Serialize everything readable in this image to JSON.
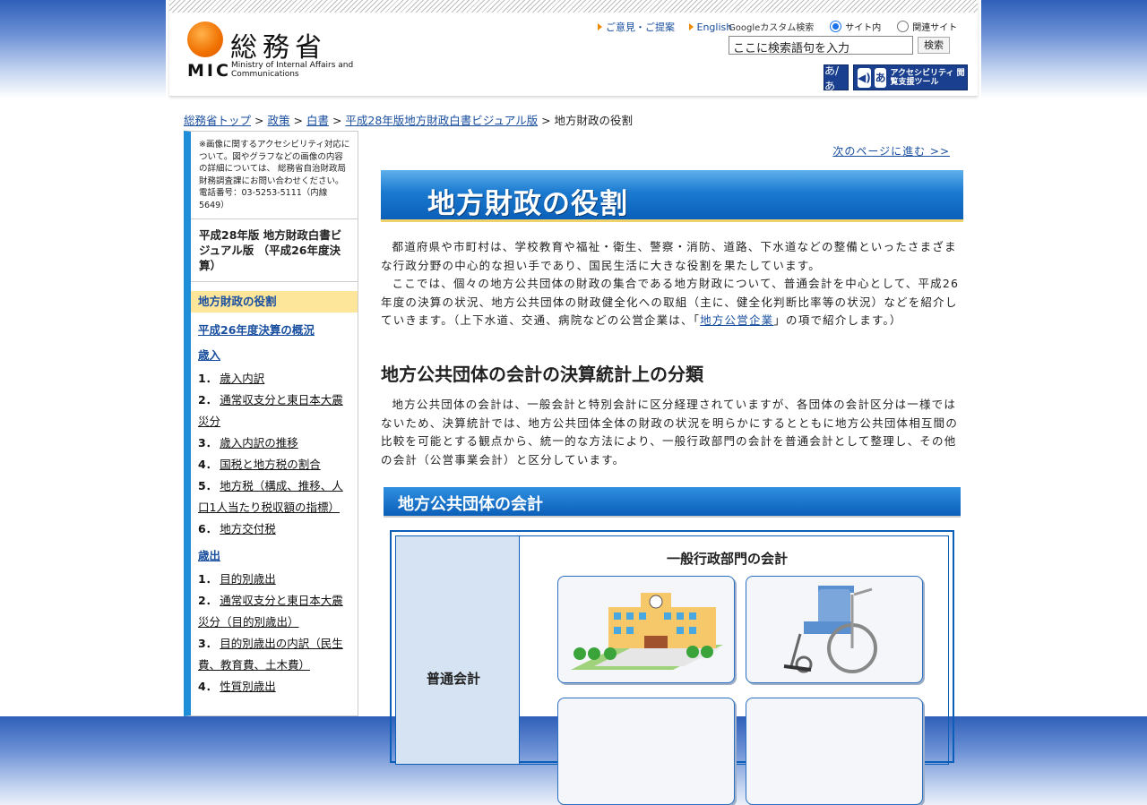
{
  "header": {
    "logo_jp": "総務省",
    "logo_mic": "MIC",
    "logo_en": "Ministry of Internal Affairs and Communications",
    "links": [
      "ご意見・ご提案",
      "English"
    ],
    "google_label": "Googleカスタム検索",
    "radio_site": "サイト内",
    "radio_related": "関連サイト",
    "search_placeholder": "ここに検索語句を入力",
    "search_button": "検索",
    "acc_small": "あ/あ",
    "acc_tool": "アクセシビリティ 閲覧支援ツール",
    "acc_icon1": "◀)",
    "acc_icon2": "あ"
  },
  "breadcrumb": {
    "items": [
      "総務省トップ",
      "政策",
      "白書",
      "平成28年版地方財政白書ビジュアル版"
    ],
    "current": "地方財政の役割",
    "sep": ">"
  },
  "sidebar": {
    "note": "※画像に関するアクセシビリティ対応について。図やグラフなどの画像の内容の詳細については、 総務省自治財政局財務調査課にお問い合わせください。電話番号：03-5253-5111（内線5649）",
    "title": "平成28年版 地方財政白書ビジュアル版 （平成26年度決算）",
    "active": "地方財政の役割",
    "overview": "平成26年度決算の概況",
    "revenue_head": "歳入",
    "revenue_items": [
      {
        "num": "1．",
        "label": "歳入内訳"
      },
      {
        "num": "2．",
        "label": "通常収支分と東日本大震災分"
      },
      {
        "num": "3．",
        "label": "歳入内訳の推移"
      },
      {
        "num": "4．",
        "label": "国税と地方税の割合"
      },
      {
        "num": "5．",
        "label": "地方税（構成、推移、人口1人当たり税収額の指標）"
      },
      {
        "num": "6．",
        "label": "地方交付税"
      }
    ],
    "expense_head": "歳出",
    "expense_items": [
      {
        "num": "1．",
        "label": "目的別歳出"
      },
      {
        "num": "2．",
        "label": "通常収支分と東日本大震災分（目的別歳出）"
      },
      {
        "num": "3．",
        "label": "目的別歳出の内訳（民生費、教育費、土木費）"
      },
      {
        "num": "4．",
        "label": "性質別歳出"
      }
    ]
  },
  "main": {
    "next_link": "次のページに進む >>",
    "banner_title": "地方財政の役割",
    "p1_a": "都道府県や市町村は、学校教育や福祉・衛生、警察・消防、道路、下水道などの整備といったさまざまな行政分野の中心的な担い手であり、国民生活に大きな役割を果たしています。",
    "p1_b": "ここでは、個々の地方公共団体の財政の集合である地方財政について、普通会計を中心として、平成26年度の決算の状況、地方公共団体の財政健全化への取組（主に、健全化判断比率等の状況）などを紹介していきます。（上下水道、交通、病院などの公営企業は、「",
    "p1_link": "地方公営企業",
    "p1_c": "」の項で紹介します。）",
    "h2": "地方公共団体の会計の決算統計上の分類",
    "p2": "地方公共団体の会計は、一般会計と特別会計に区分経理されていますが、各団体の会計区分は一様ではないため、決算統計では、地方公共団体全体の財政の状況を明らかにするとともに地方公共団体相互間の比較を可能とする観点から、統一的な方法により、一般行政部門の会計を普通会計として整理し、その他の会計（公営事業会計）と区分しています。",
    "bar_title": "地方公共団体の会計",
    "diagram_general": "一般行政部門の会計",
    "diagram_left": "普通会計"
  }
}
